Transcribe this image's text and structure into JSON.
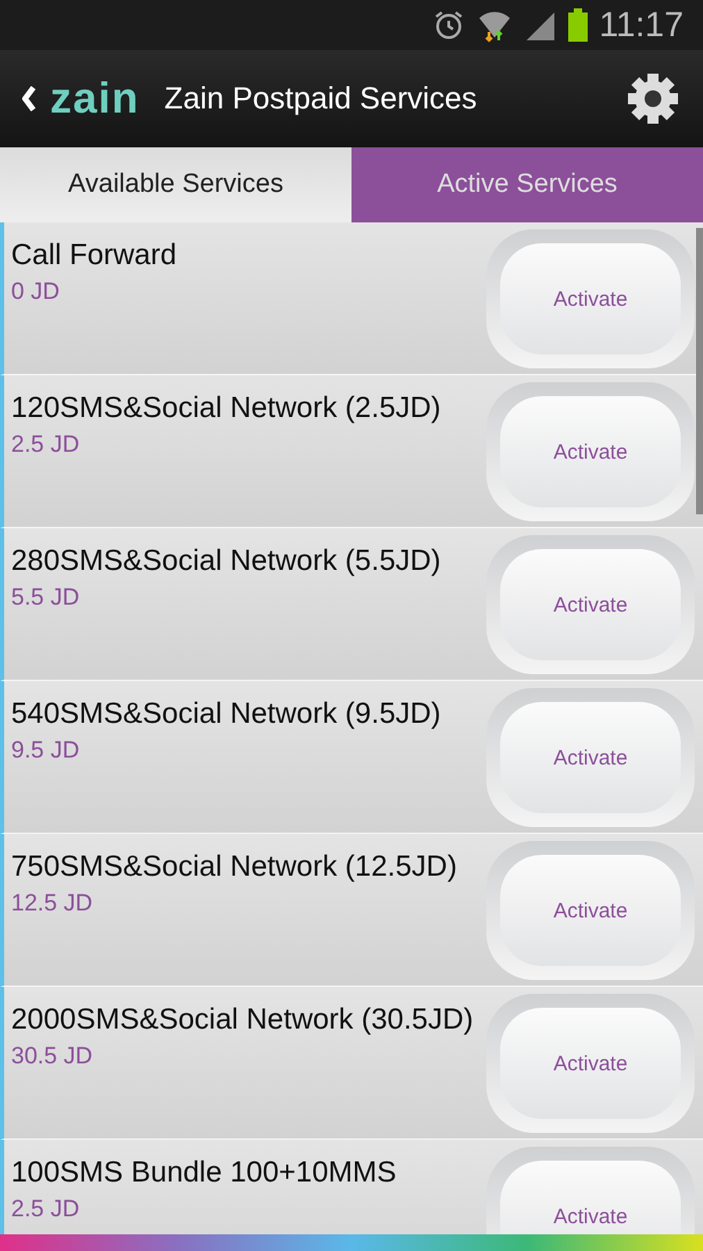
{
  "status_bar": {
    "time": "11:17"
  },
  "header": {
    "logo": "zain",
    "title": "Zain Postpaid Services"
  },
  "tabs": [
    {
      "label": "Available Services",
      "selected": true
    },
    {
      "label": "Active Services",
      "selected": false
    }
  ],
  "services": [
    {
      "name": "Call Forward",
      "price": "0 JD",
      "button": "Activate"
    },
    {
      "name": "120SMS&Social Network (2.5JD)",
      "price": "2.5 JD",
      "button": "Activate"
    },
    {
      "name": "280SMS&Social Network (5.5JD)",
      "price": "5.5 JD",
      "button": "Activate"
    },
    {
      "name": "540SMS&Social Network (9.5JD)",
      "price": "9.5 JD",
      "button": "Activate"
    },
    {
      "name": "750SMS&Social Network (12.5JD)",
      "price": "12.5 JD",
      "button": "Activate"
    },
    {
      "name": "2000SMS&Social Network (30.5JD)",
      "price": "30.5 JD",
      "button": "Activate"
    },
    {
      "name": "100SMS Bundle 100+10MMS",
      "price": "2.5 JD",
      "button": "Activate"
    }
  ]
}
